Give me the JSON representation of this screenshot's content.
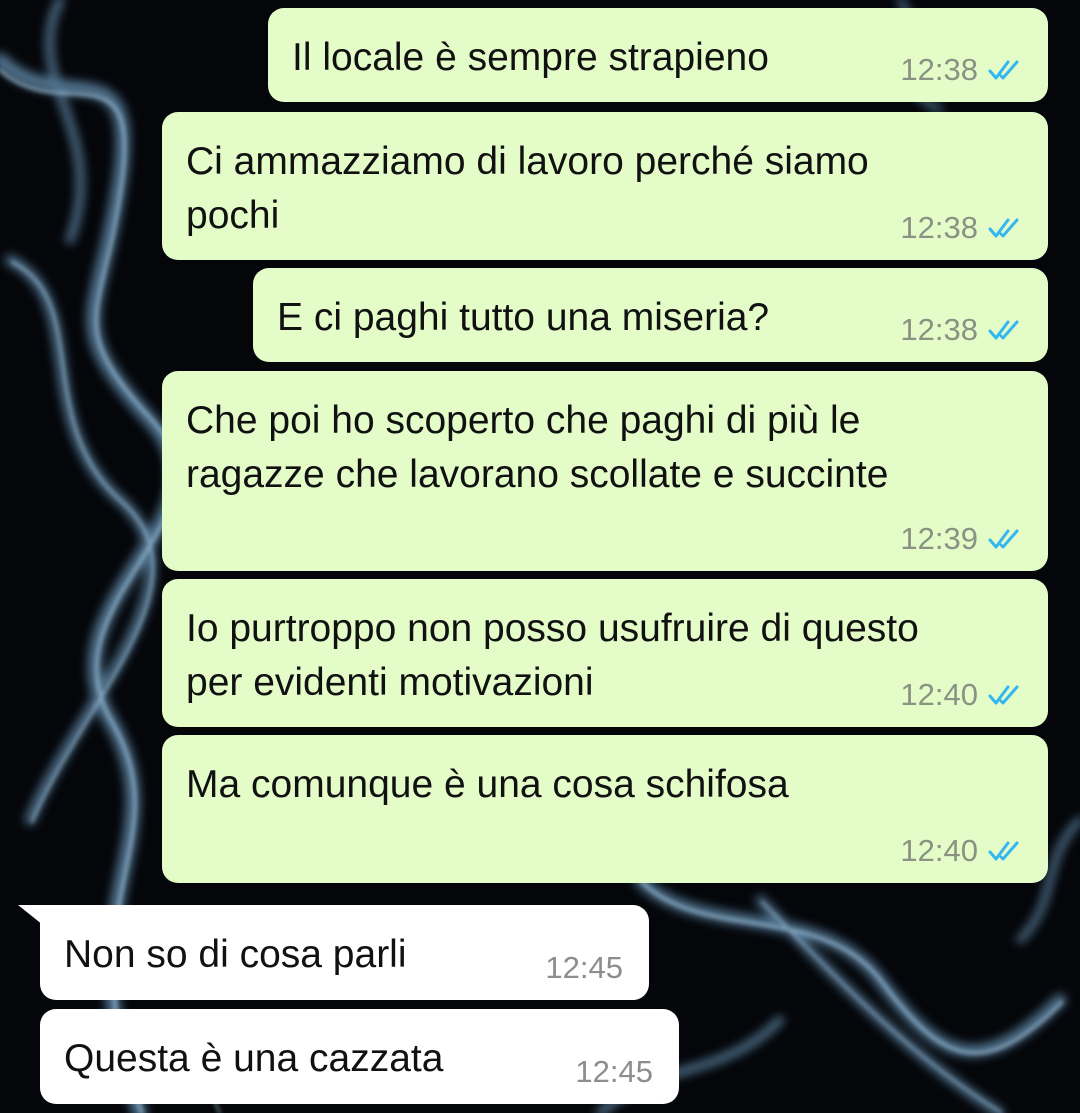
{
  "colors": {
    "outgoing_bubble": "#e3fcc8",
    "incoming_bubble": "#ffffff",
    "read_ticks": "#34b7f1",
    "timestamp": "#8a9284",
    "wallpaper": "#05070b"
  },
  "wallpaper": {
    "description_icon": "smoke-wallpaper"
  },
  "messages": [
    {
      "direction": "out",
      "lines": [
        "Il locale è sempre strapieno"
      ],
      "time": "12:38",
      "status": "read",
      "status_icon": "double-check-icon"
    },
    {
      "direction": "out",
      "lines": [
        "Ci ammazziamo di lavoro perché siamo",
        "pochi"
      ],
      "time": "12:38",
      "status": "read",
      "status_icon": "double-check-icon"
    },
    {
      "direction": "out",
      "lines": [
        "E ci paghi tutto una miseria?"
      ],
      "time": "12:38",
      "status": "read",
      "status_icon": "double-check-icon"
    },
    {
      "direction": "out",
      "lines": [
        "Che poi ho scoperto che paghi di più le",
        "ragazze che lavorano scollate e succinte"
      ],
      "time": "12:39",
      "status": "read",
      "status_icon": "double-check-icon"
    },
    {
      "direction": "out",
      "lines": [
        "Io purtroppo non posso usufruire di questo",
        "per evidenti motivazioni"
      ],
      "time": "12:40",
      "status": "read",
      "status_icon": "double-check-icon"
    },
    {
      "direction": "out",
      "lines": [
        "Ma comunque è una cosa schifosa"
      ],
      "time": "12:40",
      "status": "read",
      "status_icon": "double-check-icon"
    },
    {
      "direction": "in",
      "lines": [
        "Non so di cosa parli"
      ],
      "time": "12:45"
    },
    {
      "direction": "in",
      "lines": [
        "Questa è una cazzata"
      ],
      "time": "12:45"
    }
  ]
}
